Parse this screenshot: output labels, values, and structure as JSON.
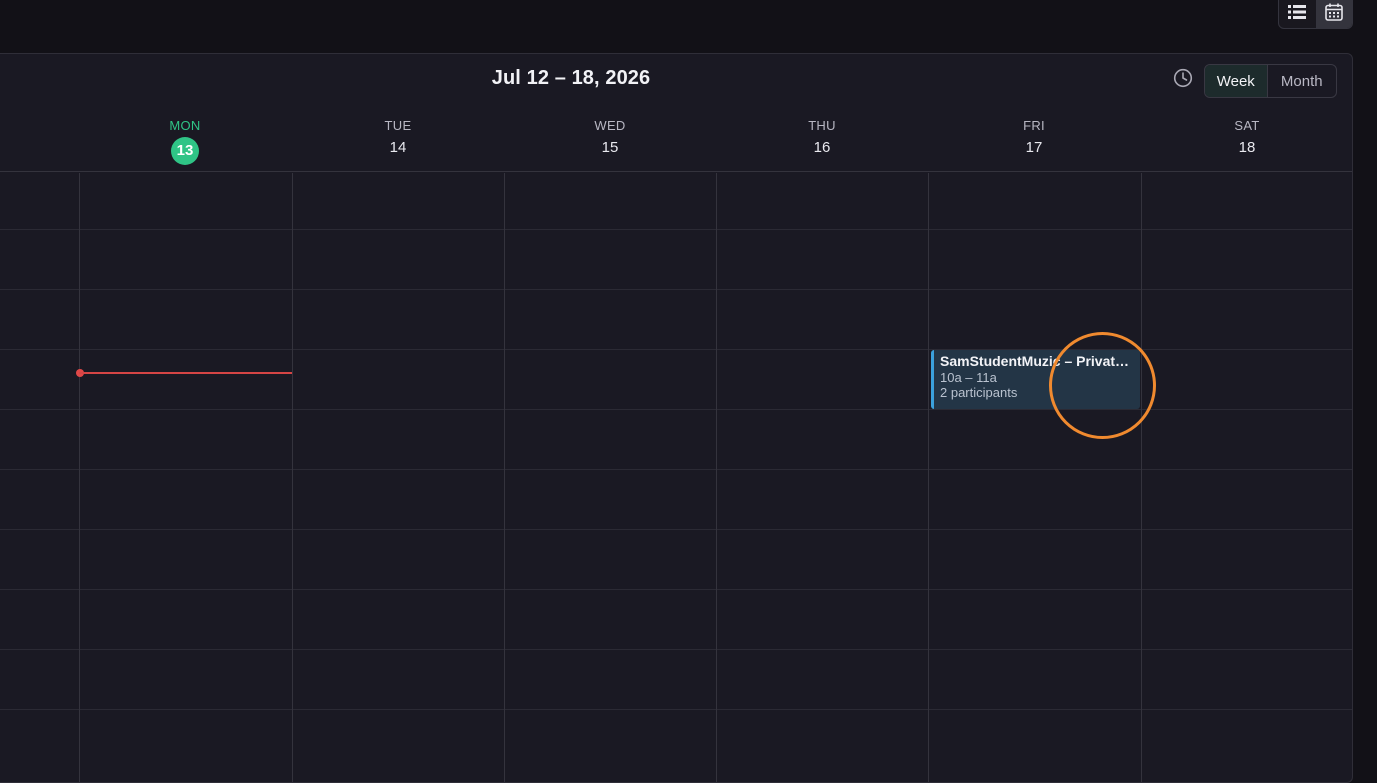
{
  "view_switch": {
    "list_icon": "list-icon",
    "calendar_icon": "calendar-icon"
  },
  "toolbar": {
    "range_title": "Jul 12 – 18, 2026",
    "clock_icon": "clock-icon",
    "week_label": "Week",
    "month_label": "Month"
  },
  "days": [
    {
      "dow": "MON",
      "num": "13",
      "today": true
    },
    {
      "dow": "TUE",
      "num": "14"
    },
    {
      "dow": "WED",
      "num": "15"
    },
    {
      "dow": "THU",
      "num": "16"
    },
    {
      "dow": "FRI",
      "num": "17"
    },
    {
      "dow": "SAT",
      "num": "18"
    }
  ],
  "event": {
    "title": "SamStudentMuzic – Private Lesson",
    "time": "10a – 11a",
    "participants": "2 participants"
  },
  "colors": {
    "today_accent": "#2fc486",
    "now_line": "#d64545",
    "event_bg": "#233546",
    "event_border": "#3ba1dc",
    "highlight": "#f08a2f"
  }
}
